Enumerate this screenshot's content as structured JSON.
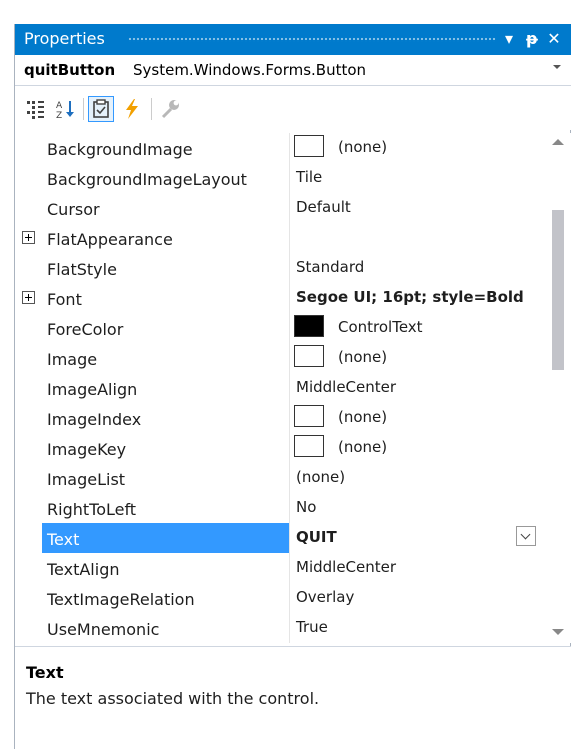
{
  "panel_title": "Properties",
  "title_buttons": {
    "dropdown": "▾",
    "pin": "ᵽ",
    "close": "✕"
  },
  "object": {
    "name": "quitButton",
    "type": "System.Windows.Forms.Button"
  },
  "toolbar": [
    "categorized-icon",
    "alphabetical-icon",
    "properties-icon",
    "events-icon",
    "property-pages-icon"
  ],
  "accent_color": "#007acc",
  "selection_color": "#3399ff",
  "properties": [
    {
      "name": "BackgroundImage",
      "value": "(none)"
    },
    {
      "name": "BackgroundImageLayout",
      "value": "Tile"
    },
    {
      "name": "Cursor",
      "value": "Default"
    },
    {
      "name": "FlatAppearance",
      "value": ""
    },
    {
      "name": "FlatStyle",
      "value": "Standard"
    },
    {
      "name": "Font",
      "value": "Segoe UI; 16pt; style=Bold"
    },
    {
      "name": "ForeColor",
      "value": "ControlText"
    },
    {
      "name": "Image",
      "value": "(none)"
    },
    {
      "name": "ImageAlign",
      "value": "MiddleCenter"
    },
    {
      "name": "ImageIndex",
      "value": "(none)"
    },
    {
      "name": "ImageKey",
      "value": "(none)"
    },
    {
      "name": "ImageList",
      "value": "(none)"
    },
    {
      "name": "RightToLeft",
      "value": "No"
    },
    {
      "name": "Text",
      "value": "QUIT"
    },
    {
      "name": "TextAlign",
      "value": "MiddleCenter"
    },
    {
      "name": "TextImageRelation",
      "value": "Overlay"
    },
    {
      "name": "UseMnemonic",
      "value": "True"
    }
  ],
  "description": {
    "title": "Text",
    "text": "The text associated with the control."
  }
}
